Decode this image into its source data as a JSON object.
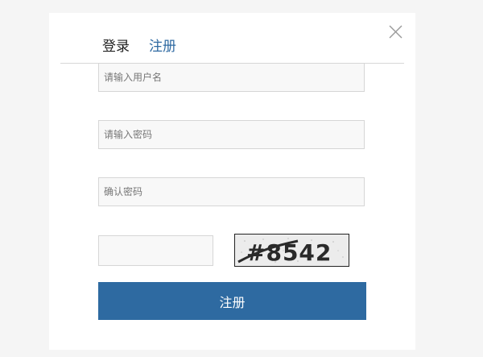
{
  "tabs": {
    "login_label": "登录",
    "register_label": "注册"
  },
  "form": {
    "username_placeholder": "请输入用户名",
    "password_placeholder": "请输入密码",
    "confirm_placeholder": "确认密码",
    "captcha_text": "#8542",
    "submit_label": "注册"
  },
  "icons": {
    "close": "close-icon"
  },
  "colors": {
    "accent": "#2e6aa1",
    "tab_active": "#2f6aa2",
    "tab_inactive": "#222222",
    "page_bg": "#f5f5f5"
  }
}
